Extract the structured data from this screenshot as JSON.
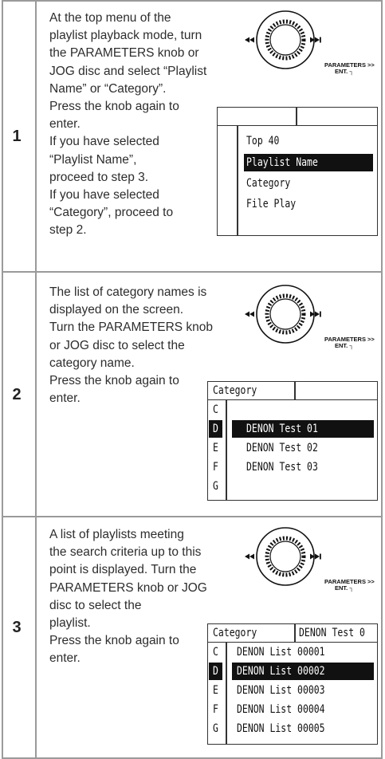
{
  "steps": [
    {
      "number": "1",
      "text": "At the top menu of the\nplaylist playback mode, turn\nthe PARAMETERS knob or\nJOG disc and select “Playlist\nName” or “Category”.\nPress the knob again to\nenter.\nIf you have selected\n“Playlist Name”,\nproceed to step 3.\nIf you have selected\n“Category”, proceed to\nstep 2.",
      "knob_label": "PARAMETERS >>",
      "knob_sub": "ENT.",
      "screen": {
        "header_left": "",
        "header_right": "",
        "letters": [],
        "items": [
          "Top 40",
          "Playlist Name",
          "Category",
          "File Play"
        ],
        "selected_index": 1
      }
    },
    {
      "number": "2",
      "text": "The list of category names is\ndisplayed on the screen.\nTurn the PARAMETERS knob\nor JOG disc to select the\ncategory name.\nPress the knob again to\nenter.",
      "knob_label": "PARAMETERS >>",
      "knob_sub": "ENT.",
      "screen": {
        "header_left": "Category",
        "header_right": "",
        "letters": [
          "C",
          "D",
          "E",
          "F",
          "G"
        ],
        "items": [
          "",
          "DENON Test 01",
          "DENON Test 02",
          "DENON Test 03",
          ""
        ],
        "selected_index": 1
      }
    },
    {
      "number": "3",
      "text": "A list of playlists meeting\nthe search criteria up to this\npoint is displayed. Turn the\nPARAMETERS knob or JOG\ndisc to select the\nplaylist.\nPress the knob again to\nenter.",
      "knob_label": "PARAMETERS >>",
      "knob_sub": "ENT.",
      "screen": {
        "header_left": "Category",
        "header_right": "DENON Test 0",
        "letters": [
          "C",
          "D",
          "E",
          "F",
          "G"
        ],
        "items": [
          "DENON List 00001",
          "DENON List 00002",
          "DENON List 00003",
          "DENON List 00004",
          "DENON List 00005"
        ],
        "selected_index": 1
      }
    }
  ]
}
